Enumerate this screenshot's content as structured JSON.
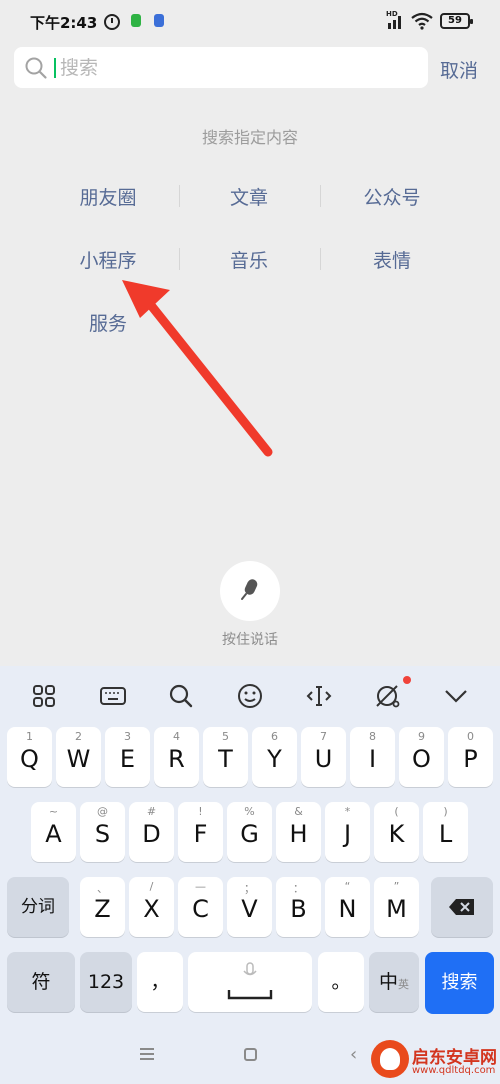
{
  "status_bar": {
    "time": "下午2:43",
    "signal_label": "HD",
    "battery": "59"
  },
  "search": {
    "placeholder": "搜索",
    "value": "",
    "cancel_label": "取消"
  },
  "hint": "搜索指定内容",
  "categories": {
    "row1": [
      "朋友圈",
      "文章",
      "公众号"
    ],
    "row2": [
      "小程序",
      "音乐",
      "表情"
    ],
    "row3": [
      "服务"
    ]
  },
  "annotation": {
    "arrow_color": "#f03a2b",
    "points_to": "小程序"
  },
  "voice": {
    "label": "按住说话"
  },
  "keyboard": {
    "toolbar_icons": [
      "grid-icon",
      "keyboard-icon",
      "search-icon",
      "emoji-icon",
      "cursor-move-icon",
      "handwriting-icon",
      "collapse-icon"
    ],
    "row1": [
      {
        "main": "Q",
        "sub": "1"
      },
      {
        "main": "W",
        "sub": "2"
      },
      {
        "main": "E",
        "sub": "3"
      },
      {
        "main": "R",
        "sub": "4"
      },
      {
        "main": "T",
        "sub": "5"
      },
      {
        "main": "Y",
        "sub": "6"
      },
      {
        "main": "U",
        "sub": "7"
      },
      {
        "main": "I",
        "sub": "8"
      },
      {
        "main": "O",
        "sub": "9"
      },
      {
        "main": "P",
        "sub": "0"
      }
    ],
    "row2": [
      {
        "main": "A",
        "sub": "~"
      },
      {
        "main": "S",
        "sub": "@"
      },
      {
        "main": "D",
        "sub": "#"
      },
      {
        "main": "F",
        "sub": "!"
      },
      {
        "main": "G",
        "sub": "%"
      },
      {
        "main": "H",
        "sub": "&"
      },
      {
        "main": "J",
        "sub": "*"
      },
      {
        "main": "K",
        "sub": "("
      },
      {
        "main": "L",
        "sub": ")"
      }
    ],
    "row3": [
      {
        "main": "Z",
        "sub": "、"
      },
      {
        "main": "X",
        "sub": "/"
      },
      {
        "main": "C",
        "sub": "—"
      },
      {
        "main": "V",
        "sub": "；"
      },
      {
        "main": "B",
        "sub": "："
      },
      {
        "main": "N",
        "sub": "“"
      },
      {
        "main": "M",
        "sub": "”"
      }
    ],
    "split_label": "分词",
    "symbol_label": "符",
    "number_label": "123",
    "comma_label": "，",
    "period_label": "。",
    "lang_label": "中",
    "lang_alt_label": "英",
    "search_label": "搜索",
    "search_color": "#1f6ff5"
  },
  "watermark": {
    "title": "启东安卓网",
    "url": "www.qdltdq.com"
  }
}
